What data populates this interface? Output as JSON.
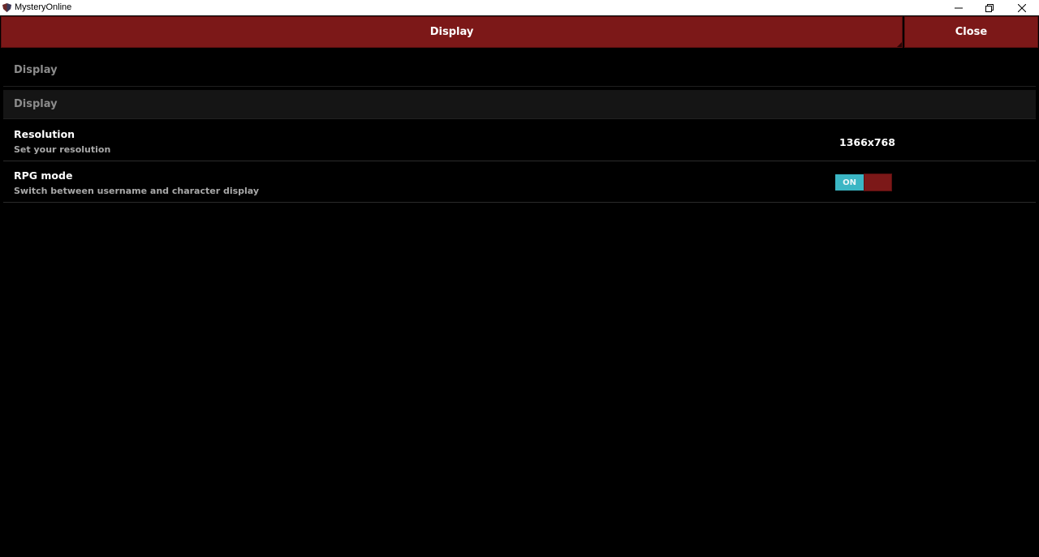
{
  "window": {
    "title": "MysteryOnline"
  },
  "header": {
    "tab_label": "Display",
    "close_label": "Close"
  },
  "sections": {
    "top_title": "Display",
    "sub_title": "Display"
  },
  "settings": [
    {
      "name": "Resolution",
      "description": "Set your resolution",
      "value": "1366x768"
    },
    {
      "name": "RPG mode",
      "description": "Switch between username and character display",
      "toggle_label": "ON",
      "toggle_state": "on"
    }
  ],
  "colors": {
    "accent_red": "#7c1818",
    "toggle_on": "#3bb6c4",
    "background": "#000000"
  },
  "icons": {
    "app": "app-shield-icon",
    "minimize": "minimize-icon",
    "maximize": "restore-icon",
    "close": "close-icon"
  }
}
